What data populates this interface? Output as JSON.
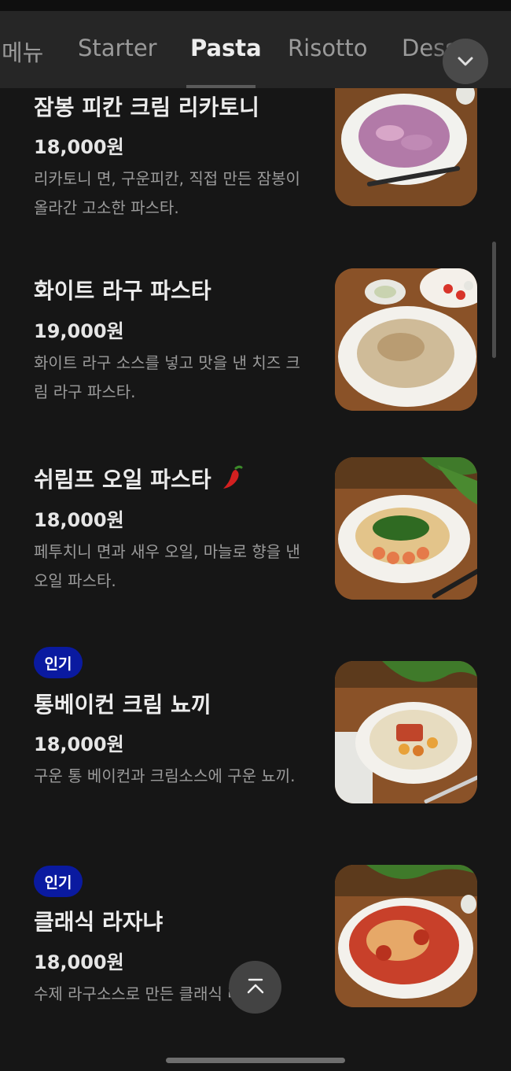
{
  "tabs": [
    {
      "label": "메뉴",
      "active": false
    },
    {
      "label": "Starter",
      "active": false
    },
    {
      "label": "Pasta",
      "active": true
    },
    {
      "label": "Risotto",
      "active": false
    },
    {
      "label": "Dessert",
      "active": false
    }
  ],
  "expand_icon": "chevron-down-icon",
  "items": [
    {
      "name": "잠봉 피칸 크림 리카토니",
      "price": "18,000원",
      "desc": "리카토니 면, 구운피칸, 직접 만든 잠봉이 올라간 고소한 파스타.",
      "badge": ""
    },
    {
      "name": "화이트 라구 파스타",
      "price": "19,000원",
      "desc": "화이트 라구 소스를 넣고 맛을 낸 치즈 크림 라구 파스타.",
      "badge": ""
    },
    {
      "name": "쉬림프 오일 파스타",
      "spicy_icon": "chili-pepper-icon",
      "price": "18,000원",
      "desc": "페투치니 면과 새우 오일, 마늘로 향을 낸 오일 파스타.",
      "badge": ""
    },
    {
      "name": "통베이컨 크림 뇨끼",
      "price": "18,000원",
      "desc": "구운 통 베이컨과 크림소스에 구운 뇨끼.",
      "badge": "인기"
    },
    {
      "name": "클래식 라자냐",
      "price": "18,000원",
      "desc": "수제 라구소스로 만든 클래식 라자냐.",
      "badge": "인기"
    }
  ],
  "scroll_top_icon": "chevron-up-icon",
  "colors": {
    "background": "#161616",
    "tabbar": "#262626",
    "badge": "#0a1aa0"
  }
}
